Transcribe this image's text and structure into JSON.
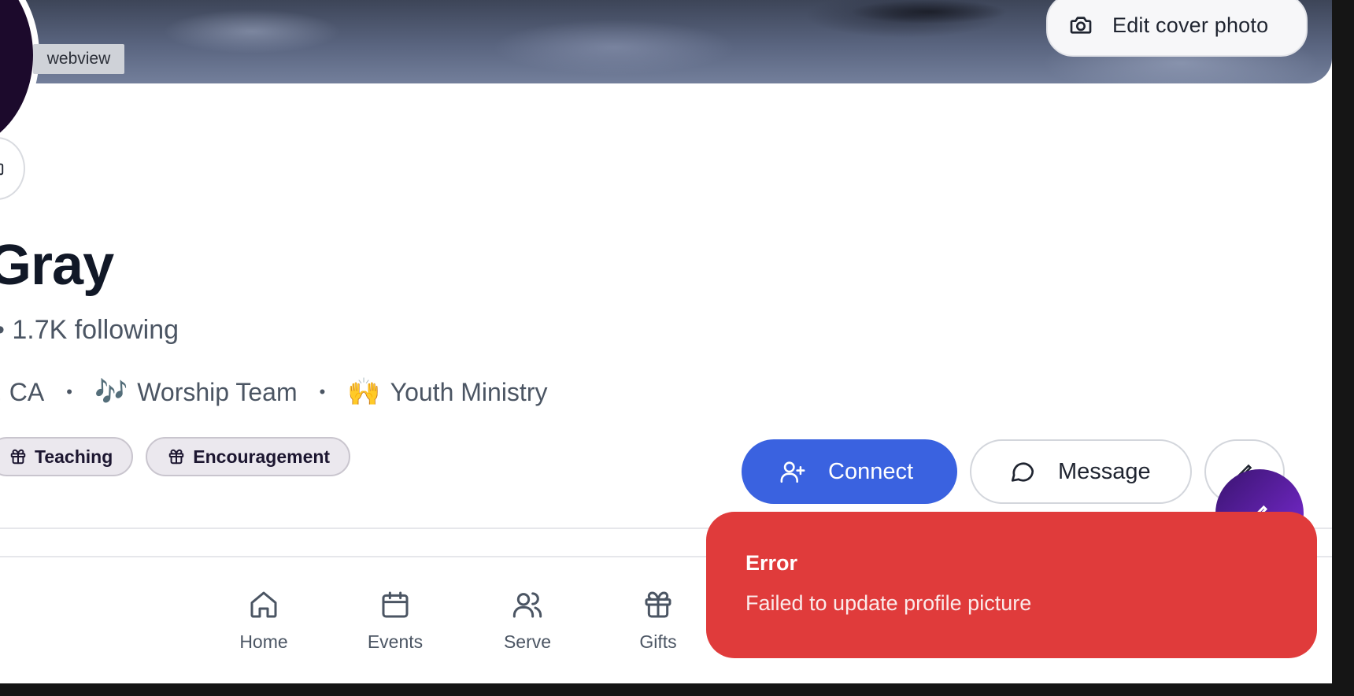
{
  "cover": {
    "edit_label": "Edit cover photo",
    "webview_tag": "webview"
  },
  "profile": {
    "name": "Gray",
    "stats": "• 1.7K following",
    "location": ", CA",
    "separator": "•",
    "ministries": [
      {
        "emoji": "🎶",
        "label": "Worship Team"
      },
      {
        "emoji": "🙌",
        "label": "Youth Ministry"
      }
    ],
    "gifts": [
      "Teaching",
      "Encouragement"
    ]
  },
  "actions": {
    "connect_label": "Connect",
    "message_label": "Message"
  },
  "nav": {
    "items": [
      {
        "label": "Home",
        "icon": "home-icon"
      },
      {
        "label": "Events",
        "icon": "calendar-icon"
      },
      {
        "label": "Serve",
        "icon": "users-icon"
      },
      {
        "label": "Gifts",
        "icon": "gift-icon"
      }
    ]
  },
  "toast": {
    "title": "Error",
    "message": "Failed to update profile picture"
  },
  "colors": {
    "primary": "#3a62e0",
    "error": "#e03b3b",
    "fab_start": "#3a1470",
    "fab_end": "#7c2bd6"
  }
}
